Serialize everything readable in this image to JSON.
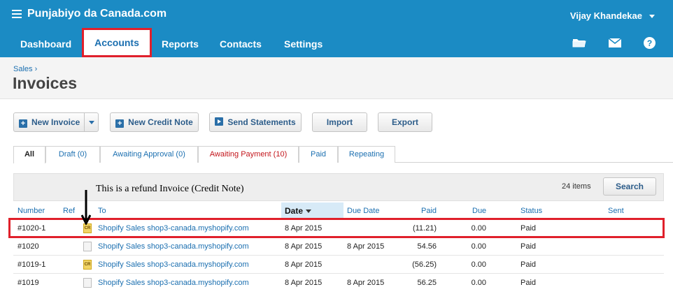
{
  "app": {
    "brand": "Punjabiyo da Canada.com",
    "user": "Vijay Khandekae"
  },
  "nav": {
    "dashboard": "Dashboard",
    "accounts": "Accounts",
    "reports": "Reports",
    "contacts": "Contacts",
    "settings": "Settings",
    "icons": [
      "folder-icon",
      "mail-icon",
      "help-icon"
    ]
  },
  "header": {
    "breadcrumb": "Sales ›",
    "title": "Invoices"
  },
  "toolbar": {
    "new_invoice": "New Invoice",
    "new_credit_note": "New Credit Note",
    "send_statements": "Send Statements",
    "import": "Import",
    "export": "Export"
  },
  "tabs": [
    {
      "label": "All"
    },
    {
      "label": "Draft (0)"
    },
    {
      "label": "Awaiting Approval (0)"
    },
    {
      "label": "Awaiting Payment (10)"
    },
    {
      "label": "Paid"
    },
    {
      "label": "Repeating"
    }
  ],
  "panel": {
    "annotation": "This is a refund Invoice (Credit Note)",
    "items_count": "24 items",
    "search": "Search"
  },
  "table": {
    "columns": {
      "number": "Number",
      "ref": "Ref",
      "to": "To",
      "date": "Date",
      "due_date": "Due Date",
      "paid": "Paid",
      "due": "Due",
      "status": "Status",
      "sent": "Sent"
    },
    "rows": [
      {
        "number": "#1020-1",
        "icon": "credit-note-icon",
        "icon_text": "CR",
        "to": "Shopify Sales shop3-canada.myshopify.com",
        "date": "8 Apr 2015",
        "due_date": "",
        "paid": "(11.21)",
        "due": "0.00",
        "status": "Paid"
      },
      {
        "number": "#1020",
        "icon": "document-icon",
        "icon_text": "",
        "to": "Shopify Sales shop3-canada.myshopify.com",
        "date": "8 Apr 2015",
        "due_date": "8 Apr 2015",
        "paid": "54.56",
        "due": "0.00",
        "status": "Paid"
      },
      {
        "number": "#1019-1",
        "icon": "credit-note-icon",
        "icon_text": "CR",
        "to": "Shopify Sales shop3-canada.myshopify.com",
        "date": "8 Apr 2015",
        "due_date": "",
        "paid": "(56.25)",
        "due": "0.00",
        "status": "Paid"
      },
      {
        "number": "#1019",
        "icon": "document-icon",
        "icon_text": "",
        "to": "Shopify Sales shop3-canada.myshopify.com",
        "date": "8 Apr 2015",
        "due_date": "8 Apr 2015",
        "paid": "56.25",
        "due": "0.00",
        "status": "Paid"
      }
    ]
  },
  "colors": {
    "topbar": "#1b8bc4",
    "highlight": "#e0202b",
    "link": "#1b6fb0"
  }
}
